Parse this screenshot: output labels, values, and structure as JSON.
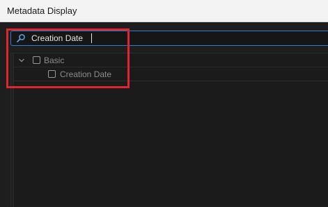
{
  "window": {
    "title": "Metadata Display"
  },
  "search": {
    "value": "Creation Date"
  },
  "tree": {
    "group": {
      "label": "Basic",
      "checked": false,
      "expanded": true,
      "items": [
        {
          "label": "Creation Date",
          "checked": false
        }
      ]
    }
  },
  "colors": {
    "accent_focus": "#2d7dd2",
    "highlight_annotation": "#e1252e"
  },
  "icons": {
    "search": "search-icon",
    "expand": "chevron-down-icon",
    "checkbox": "checkbox-icon"
  }
}
